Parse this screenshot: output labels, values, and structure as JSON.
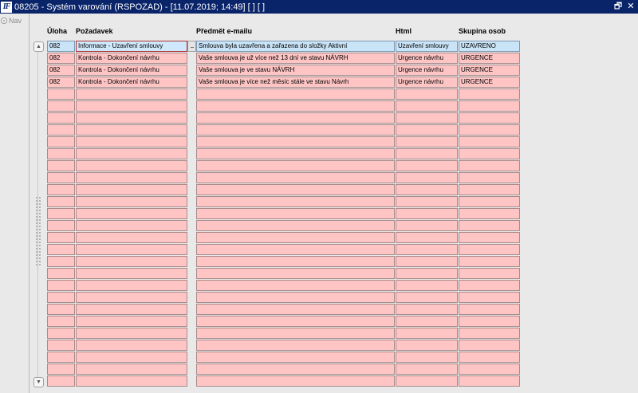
{
  "window": {
    "app_icon_text": "IF",
    "title": "08205 - Systém varování (RSPOZAD) - [11.07.2019; 14:49]  [ ]  [ ]",
    "restore_glyph": "🗗",
    "close_glyph": "✕"
  },
  "sidebar": {
    "nav_label": "Nav"
  },
  "scroll": {
    "up_glyph": "▲",
    "down_glyph": "▼"
  },
  "table": {
    "columns": [
      "Úloha",
      "Požadavek",
      "Předmět e-mailu",
      "Html",
      "Skupina osob"
    ],
    "lov_button_label": "...",
    "rows": [
      [
        "082",
        "Informace - Uzavření smlouvy",
        "Smlouva byla uzavřena a zařazena do složky Aktivní",
        "Uzavření smlouvy",
        "UZAVRENO"
      ],
      [
        "082",
        "Kontrola - Dokončení návrhu",
        "Vaše smlouva je už více než 13 dní ve stavu NÁVRH",
        "Urgence návrhu",
        "URGENCE"
      ],
      [
        "082",
        "Kontrola - Dokončení návrhu",
        "Vaše smlouva je ve stavu NÁVRH",
        "Urgence návrhu",
        "URGENCE"
      ],
      [
        "082",
        "Kontrola - Dokončení návrhu",
        "Vaše smlouva je více než měsíc stále ve stavu Návrh",
        "Urgence návrhu",
        "URGENCE"
      ]
    ],
    "selected_row": 0,
    "total_rows": 29
  }
}
